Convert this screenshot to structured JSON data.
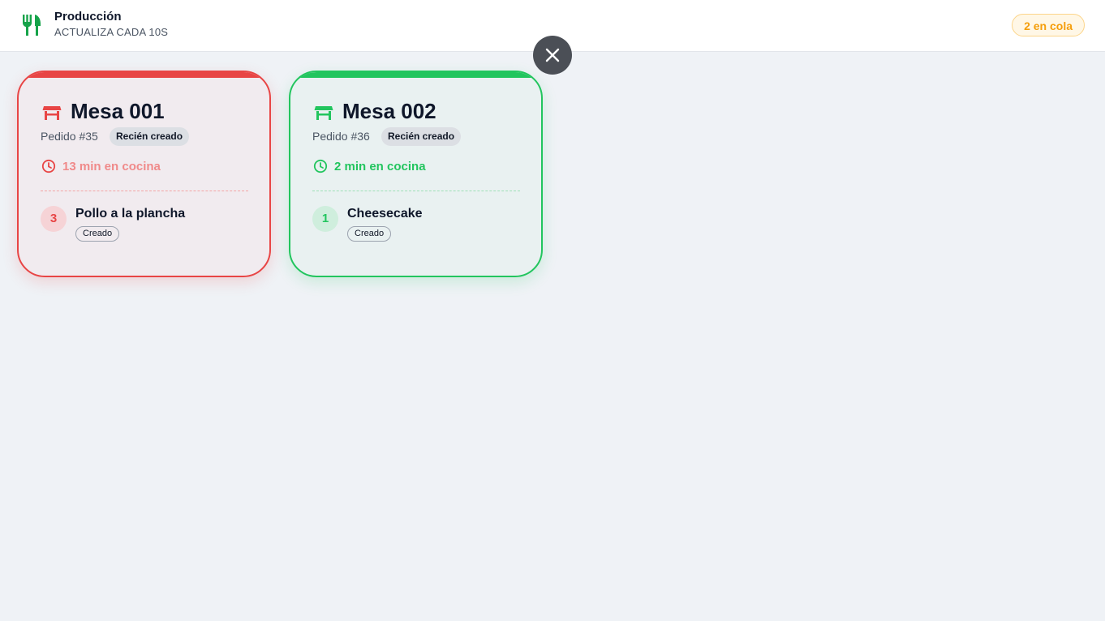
{
  "header": {
    "title": "Producción",
    "subtitle": "ACTUALIZA CADA 10S",
    "queue_badge": "2 en cola",
    "icon": "utensils-icon"
  },
  "close_button": {
    "icon": "close-icon"
  },
  "colors": {
    "urgent": "#e84545",
    "ok": "#22c55e",
    "queue": "#f59e0b"
  },
  "orders": [
    {
      "table": "Mesa 001",
      "order": "Pedido #35",
      "status": "Recién creado",
      "time": "13 min en cocina",
      "state_color": "red",
      "items": [
        {
          "qty": "3",
          "name": "Pollo a la plancha",
          "status": "Creado"
        }
      ]
    },
    {
      "table": "Mesa 002",
      "order": "Pedido #36",
      "status": "Recién creado",
      "time": "2 min en cocina",
      "state_color": "green",
      "items": [
        {
          "qty": "1",
          "name": "Cheesecake",
          "status": "Creado"
        }
      ]
    }
  ]
}
